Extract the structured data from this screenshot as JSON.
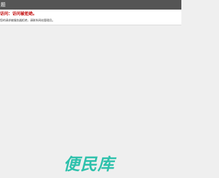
{
  "window": {
    "title": "题"
  },
  "message": {
    "title": "访问：访问被拒绝。",
    "description": "您的请求被服务器拒绝，请联系网站管理员。"
  },
  "watermark": {
    "text": "便民库",
    "color": "#2ec1ac"
  }
}
